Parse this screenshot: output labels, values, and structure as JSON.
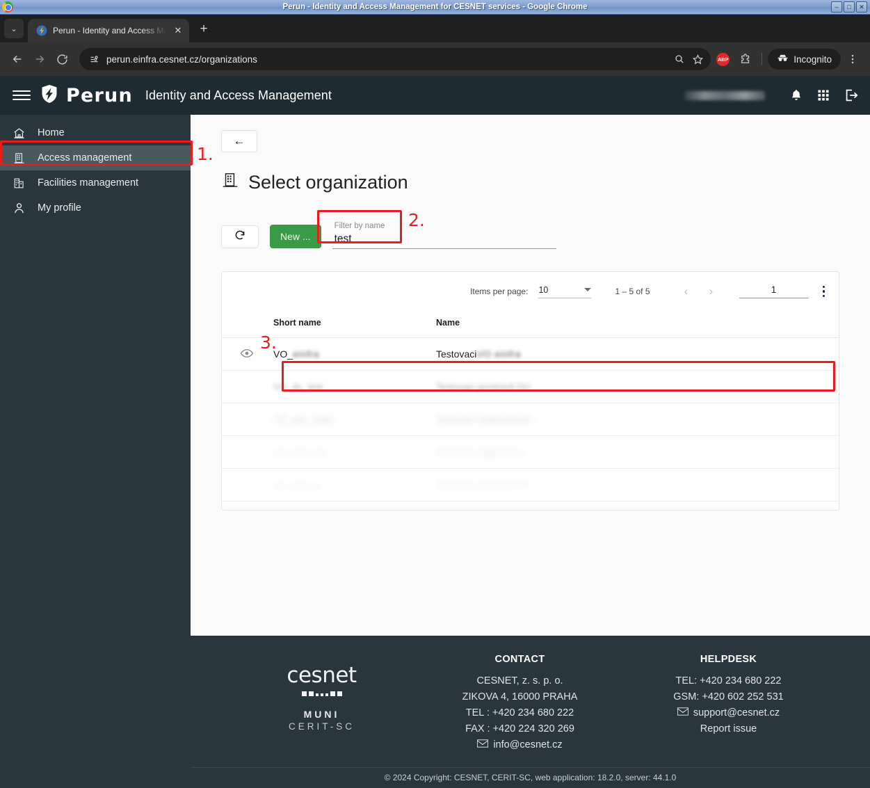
{
  "os_window": {
    "title": "Perun - Identity and Access Management for CESNET services - Google Chrome",
    "minimize_label": "–",
    "maximize_label": "□",
    "close_label": "✕"
  },
  "browser": {
    "tab": {
      "title": "Perun - Identity and Access Ma",
      "favicon_name": "perun-lightning-favicon",
      "close_label": "✕"
    },
    "new_tab_label": "+",
    "tab_list_chevron": "⌄",
    "back_label": "←",
    "forward_label": "→",
    "reload_label": "⟳",
    "url": "perun.einfra.cesnet.cz/organizations",
    "site_info_icon": "page-info-icon",
    "zoom_icon": "search-zoom-icon",
    "bookmark_icon": "star-icon",
    "extension_abp_label": "ABP",
    "extensions_icon": "puzzle-piece-icon",
    "incognito_label": "Incognito",
    "menu_icon": "three-dot-menu-icon"
  },
  "app_header": {
    "menu_icon": "hamburger-menu-icon",
    "brand": "Perun",
    "subtitle": "Identity and Access Management",
    "user_name_redacted": "",
    "notifications_icon": "bell-icon",
    "apps_icon": "apps-grid-icon",
    "logout_icon": "logout-icon"
  },
  "sidebar": {
    "items": [
      {
        "label": "Home",
        "icon": "home-icon",
        "active": false
      },
      {
        "label": "Access management",
        "icon": "apartment-icon",
        "active": true
      },
      {
        "label": "Facilities management",
        "icon": "domain-icon",
        "active": false
      },
      {
        "label": "My profile",
        "icon": "person-icon",
        "active": false
      }
    ]
  },
  "main": {
    "back_button_label": "←",
    "page_title": "Select organization",
    "page_title_icon": "apartment-icon",
    "refresh_button_icon": "refresh-icon",
    "new_button_label": "New ...",
    "filter": {
      "label": "Filter by name",
      "value": "test",
      "placeholder": "Filter by name"
    },
    "paginator": {
      "items_per_page_label": "Items per page:",
      "items_per_page_value": "10",
      "range_label": "1 – 5 of 5",
      "prev_label": "‹",
      "next_label": "›",
      "page_value": "1",
      "options_icon": "vertical-dots-icon"
    },
    "table": {
      "columns": [
        "",
        "Short name",
        "Name"
      ],
      "rows": [
        {
          "eye_icon": "visibility-eye-icon",
          "short_name_prefix": "VO_",
          "short_name_redacted": "einfra",
          "name_prefix": "Testovaci",
          "name_redacted": "VO einfra",
          "highlighted": true
        },
        {
          "eye_icon": "visibility-eye-icon",
          "short_name_prefix": "",
          "short_name_redacted": "VO_du_test",
          "name_prefix": "",
          "name_redacted": "Testovaci prostredi DU",
          "highlighted": false
        },
        {
          "eye_icon": "visibility-eye-icon",
          "short_name_prefix": "",
          "short_name_redacted": "VO_test_meta",
          "name_prefix": "",
          "name_redacted": "Testovaci metacentrum",
          "highlighted": false
        },
        {
          "eye_icon": "visibility-eye-icon",
          "short_name_prefix": "",
          "short_name_redacted": "VO_test_org",
          "name_prefix": "",
          "name_redacted": "Testovaci organizace",
          "highlighted": false
        },
        {
          "eye_icon": "visibility-eye-icon",
          "short_name_prefix": "",
          "short_name_redacted": "VO_test_tp",
          "name_prefix": "",
          "name_redacted": "Testovaci prostredi TP",
          "highlighted": false
        }
      ]
    }
  },
  "annotations": {
    "step1": "1.",
    "step2": "2.",
    "step3": "3.",
    "color": "#ed1c1c"
  },
  "footer": {
    "logo": {
      "wordmark": "cesnet",
      "muni": "MUNI",
      "cerit": "CERIT-SC"
    },
    "contact": {
      "heading": "CONTACT",
      "lines": [
        "CESNET, z. s. p. o.",
        "ZIKOVA 4, 16000 PRAHA",
        "TEL : +420 234 680 222",
        "FAX : +420 224 320 269"
      ],
      "email": "info@cesnet.cz",
      "email_icon": "mail-icon"
    },
    "helpdesk": {
      "heading": "HELPDESK",
      "lines": [
        "TEL: +420 234 680 222",
        "GSM: +420 602 252 531"
      ],
      "email": "support@cesnet.cz",
      "email_icon": "mail-icon",
      "report_issue": "Report issue"
    },
    "copyright": "© 2024 Copyright: CESNET, CERIT-SC, web application: 18.2.0, server: 44.1.0"
  },
  "colors": {
    "header_bg": "#1e2b33",
    "sidebar_bg": "#2a363d",
    "sidebar_active_bg": "#4a585f",
    "new_button_green": "#3a9b46",
    "annotation_red": "#ed1c1c",
    "footer_bg": "#2a363d"
  }
}
